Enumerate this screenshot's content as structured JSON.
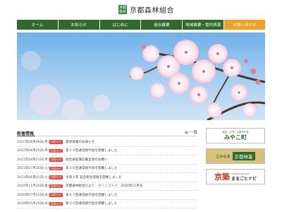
{
  "header": {
    "logo_mark": "京都森林",
    "site_name": "京都森林組合"
  },
  "nav": [
    {
      "label": "ホーム"
    },
    {
      "label": "お知らせ"
    },
    {
      "label": "はじめに"
    },
    {
      "label": "組合概要"
    },
    {
      "label": "地域概要・管内資源"
    },
    {
      "label": "お問い合わせ"
    }
  ],
  "news": {
    "section_title": "新着情報",
    "list_link": "一覧",
    "items": [
      {
        "date": "2022年08月09日(月)",
        "badge": "お知らせ",
        "title": "夏季休業のお知らせ"
      },
      {
        "date": "2022年08月05日(月)",
        "badge": "お知らせ",
        "title": "第３９回通常総代会を開催しました"
      },
      {
        "date": "2021年08月23日(月)",
        "badge": "お知らせ",
        "title": "組合員名簿記載変更のお願い"
      },
      {
        "date": "2021年07月20日(火)",
        "badge": "お知らせ",
        "title": "第３８回通常総代会を開催しました"
      },
      {
        "date": "2021年06月01日(火)",
        "badge": "お知らせ",
        "title": "令和３年 安全衛生取組を開催しました"
      },
      {
        "date": "2020年11月20日(金)",
        "badge": "お知らせ",
        "title": "京都森林組合だより　モリノコトバ　2020年11月号"
      },
      {
        "date": "2020年07月22日(水)",
        "badge": "お知らせ",
        "title": "第３７回通常総代会を開催しました"
      },
      {
        "date": "2019年05月29日(水)",
        "badge": "お知らせ",
        "title": "第３６回通常総代会を開催しました"
      }
    ]
  },
  "banners": {
    "b1": {
      "small": "都会・近郊・京都市の里",
      "big": "みやこ町"
    },
    "b2": {
      "left": "じゃらる",
      "right": "京都林業"
    },
    "b3": {
      "logo": "京築",
      "small": "KANKOKENJI NAVI",
      "big": "まるごとナビ"
    }
  },
  "colors": {
    "nav_green": "#2e6b2a",
    "nav_active": "#f0a020",
    "badge_red": "#e0443a",
    "sky": "#6fb0e8"
  }
}
